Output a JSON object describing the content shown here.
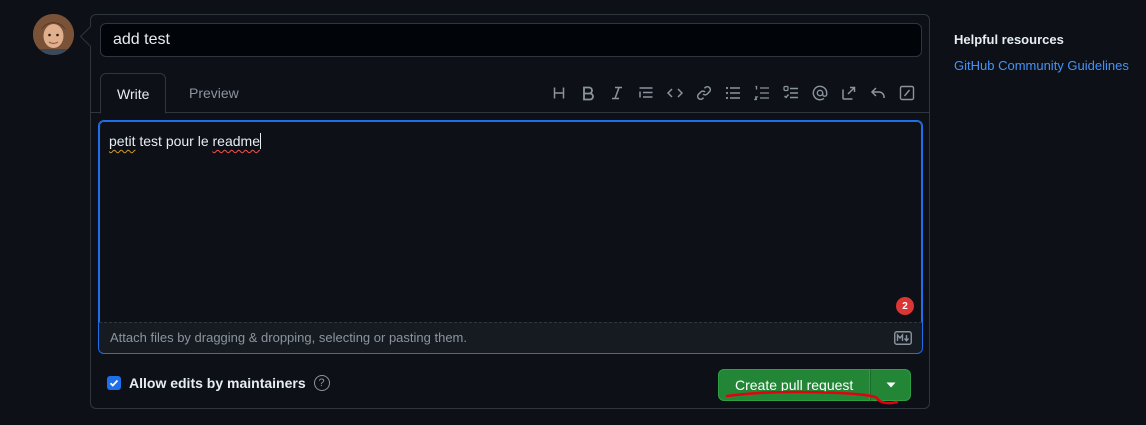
{
  "pr": {
    "title_value": "add test",
    "tabs": {
      "write": "Write",
      "preview": "Preview"
    },
    "toolbar_icons": [
      "heading-icon",
      "bold-icon",
      "italic-icon",
      "quote-icon",
      "code-icon",
      "link-icon",
      "unordered-list-icon",
      "ordered-list-icon",
      "task-list-icon",
      "mention-icon",
      "cross-reference-icon",
      "reply-icon",
      "slash-commands-icon"
    ],
    "body": {
      "word1": "petit",
      "middle": " test pour le ",
      "word2": "readme"
    },
    "counter": "2",
    "attach_text": "Attach files by dragging & dropping, selecting or pasting them.",
    "allow_edits_label": "Allow edits by maintainers",
    "help_glyph": "?",
    "create_button": "Create pull request"
  },
  "sidebar": {
    "title": "Helpful resources",
    "link": "GitHub Community Guidelines"
  },
  "colors": {
    "accent": "#1f6feb",
    "primary_button": "#238636",
    "annotation": "#e3000f"
  }
}
